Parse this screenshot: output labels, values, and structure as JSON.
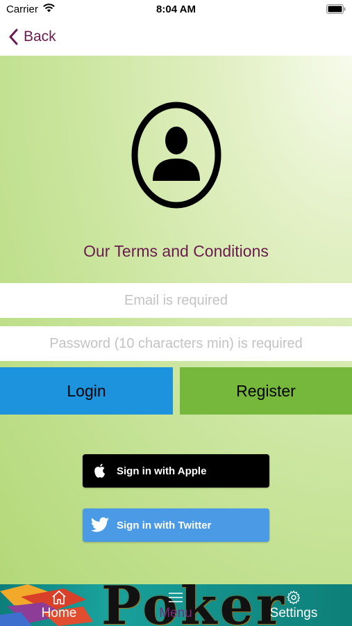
{
  "status_bar": {
    "carrier": "Carrier",
    "time": "8:04 AM"
  },
  "nav": {
    "back_label": "Back"
  },
  "terms": {
    "label": "Our Terms and Conditions"
  },
  "form": {
    "email_placeholder": "Email is required",
    "password_placeholder": "Password (10 characters min) is required"
  },
  "buttons": {
    "login": "Login",
    "register": "Register"
  },
  "social": {
    "apple": "Sign in with Apple",
    "twitter": "Sign in with Twitter"
  },
  "tab_bar": {
    "banner_text": "Poker",
    "tabs": [
      {
        "label": "Home",
        "icon": "home-icon"
      },
      {
        "label": "Menu",
        "icon": "menu-icon"
      },
      {
        "label": "Settings",
        "icon": "gear-icon"
      }
    ]
  },
  "colors": {
    "accent": "#6a1b4d",
    "login": "#1e93dd",
    "register": "#76b83b",
    "twitter": "#4a9ae6",
    "tab_bar": "#14908a"
  }
}
